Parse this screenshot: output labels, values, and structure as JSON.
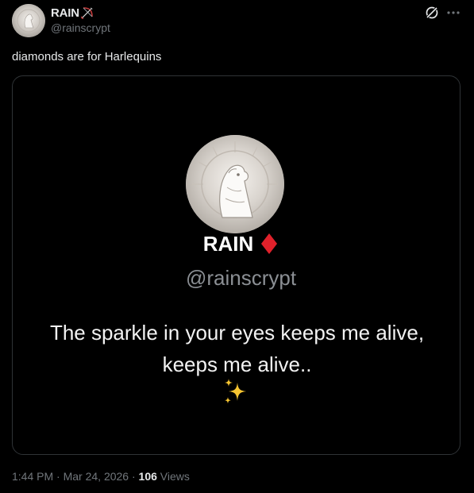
{
  "author": {
    "name": "RAIN",
    "handle": "@rainscrypt",
    "name_emoji_icon": "bow-and-arrow-icon"
  },
  "header_actions": {
    "grok_icon": "grok-icon",
    "more_icon": "more-options-icon"
  },
  "post": {
    "text": "diamonds are for Harlequins"
  },
  "media": {
    "name": "RAIN",
    "name_emoji_icon": "red-diamond-icon",
    "handle": "@rainscrypt",
    "quote_line_1": "The sparkle in your eyes keeps me alive,",
    "quote_line_2": "keeps me alive..",
    "sparkles_icon": "sparkles-icon"
  },
  "meta": {
    "time": "1:44 PM",
    "separator_1": " · ",
    "date": "Mar 24, 2026",
    "separator_2": " · ",
    "views_count": "106",
    "views_label": " Views"
  },
  "colors": {
    "background": "#000000",
    "primary_text": "#e7e9ea",
    "secondary_text": "#71767b",
    "card_border": "#2f3336",
    "diamond": "#e0212b"
  }
}
